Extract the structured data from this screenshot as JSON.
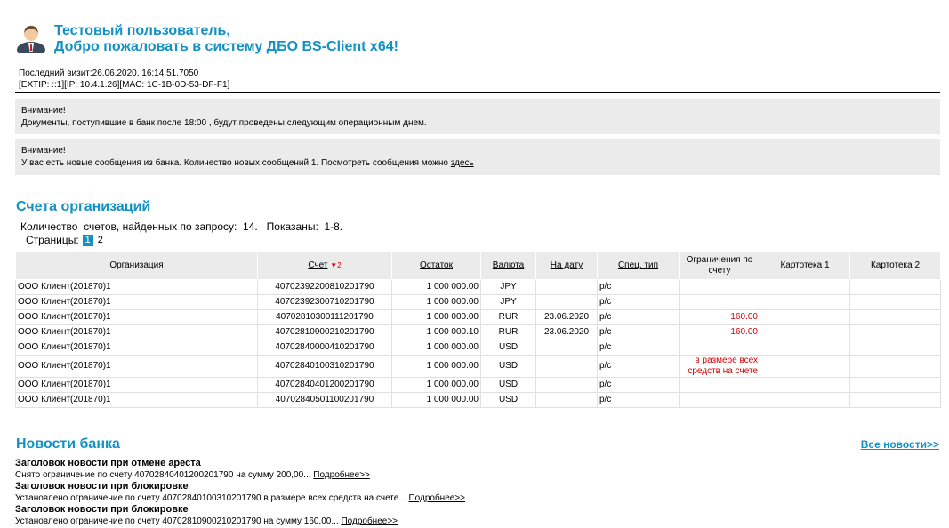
{
  "header": {
    "line1": "Тестовый пользователь,",
    "line2": "Добро пожаловать в систему ДБО BS-Client x64!",
    "last_visit": "Последний визит:26.06.2020, 16:14:51.7050",
    "network": "[EXTIP: ::1][IP: 10.4.1.26][MAC: 1C-1B-0D-53-DF-F1]"
  },
  "notices": [
    {
      "title": "Внимание!",
      "text": "Документы, поступившие в банк после 18:00 , будут проведены следующим операционным днем.",
      "link": ""
    },
    {
      "title": "Внимание!",
      "text": "У вас есть новые сообщения из банка. Количество новых сообщений:1. Посмотреть сообщения можно ",
      "link": "здесь"
    }
  ],
  "accounts": {
    "title": "Счета организаций",
    "count_line": "Количество  счетов, найденных по запросу:  14.   Показаны:  1-8.",
    "pages_label": "Страницы:",
    "pages": [
      "1",
      "2"
    ],
    "columns": {
      "org": "Организация",
      "number": "Счет",
      "sort_marker": "▼2",
      "balance": "Остаток",
      "currency": "Валюта",
      "date": "На дату",
      "spec": "Спец. тип",
      "limits": "Ограничения по счету",
      "card1": "Картотека 1",
      "card2": "Картотека 2"
    },
    "rows": [
      {
        "org": "ООО Клиент(201870)1",
        "number": "40702392200810201790",
        "balance": "1 000 000.00",
        "currency": "JPY",
        "date": "",
        "spec": "р/с",
        "limits": ""
      },
      {
        "org": "ООО Клиент(201870)1",
        "number": "40702392300710201790",
        "balance": "1 000 000.00",
        "currency": "JPY",
        "date": "",
        "spec": "р/с",
        "limits": ""
      },
      {
        "org": "ООО Клиент(201870)1",
        "number": "40702810300111201790",
        "balance": "1 000 000.00",
        "currency": "RUR",
        "date": "23.06.2020",
        "spec": "р/с",
        "limits": "160.00"
      },
      {
        "org": "ООО Клиент(201870)1",
        "number": "40702810900210201790",
        "balance": "1 000 000.10",
        "currency": "RUR",
        "date": "23.06.2020",
        "spec": "р/с",
        "limits": "160.00"
      },
      {
        "org": "ООО Клиент(201870)1",
        "number": "40702840000410201790",
        "balance": "1 000 000.00",
        "currency": "USD",
        "date": "",
        "spec": "р/с",
        "limits": ""
      },
      {
        "org": "ООО Клиент(201870)1",
        "number": "40702840100310201790",
        "balance": "1 000 000.00",
        "currency": "USD",
        "date": "",
        "spec": "р/с",
        "limits": "в размере всех средств на счете"
      },
      {
        "org": "ООО Клиент(201870)1",
        "number": "40702840401200201790",
        "balance": "1 000 000.00",
        "currency": "USD",
        "date": "",
        "spec": "р/с",
        "limits": ""
      },
      {
        "org": "ООО Клиент(201870)1",
        "number": "40702840501100201790",
        "balance": "1 000 000.00",
        "currency": "USD",
        "date": "",
        "spec": "р/с",
        "limits": ""
      }
    ]
  },
  "news": {
    "title": "Новости банка",
    "all_link": "Все новости>>",
    "more_label": "Подробнее>>",
    "items": [
      {
        "title": "Заголовок новости при отмене ареста",
        "text": "Снято ограничение по счету 40702840401200201790 на сумму 200,00..."
      },
      {
        "title": "Заголовок новости при блокировке",
        "text": "Установлено ограничение по счету 40702840100310201790 в размере всех средств на счете..."
      },
      {
        "title": "Заголовок новости при блокировке",
        "text": "Установлено ограничение по счету 40702810900210201790 на сумму 160,00..."
      }
    ]
  }
}
